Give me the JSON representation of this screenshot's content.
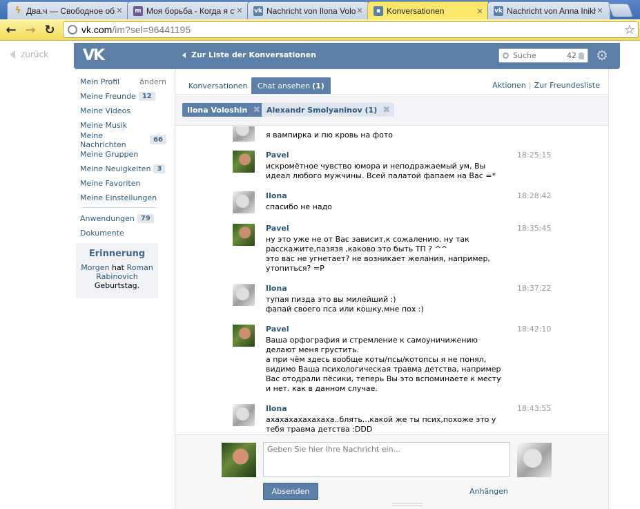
{
  "browser": {
    "tabs": [
      {
        "title": "Два.ч — Свободное общ",
        "icon": "lightning-icon",
        "active": false
      },
      {
        "title": "Моя борьба - Когда я ст",
        "icon": "m-favicon",
        "active": false
      },
      {
        "title": "Nachricht von Ilona Volosh",
        "icon": "vk-favicon",
        "active": false
      },
      {
        "title": "Konversationen",
        "icon": "chat-favicon",
        "active": true
      },
      {
        "title": "Nachricht von Anna Inikho",
        "icon": "vk-favicon",
        "active": false
      }
    ],
    "url_host": "vk.com",
    "url_path": "/im?sel=96441195"
  },
  "vk": {
    "back_label": "zurück",
    "header_link": "Zur Liste der Konversationen",
    "search_placeholder": "Suche",
    "search_count": "42"
  },
  "sidebar": {
    "profile": "Mein Profil",
    "change": "ändern",
    "items": [
      {
        "label": "Meine Freunde",
        "badge": "12"
      },
      {
        "label": "Meine Videos",
        "badge": ""
      },
      {
        "label": "Meine Musik",
        "badge": ""
      },
      {
        "label": "Meine Nachrichten",
        "badge": "66"
      },
      {
        "label": "Meine Gruppen",
        "badge": ""
      },
      {
        "label": "Meine Neuigkeiten",
        "badge": "3"
      },
      {
        "label": "Meine Favoriten",
        "badge": ""
      },
      {
        "label": "Meine Einstellungen",
        "badge": ""
      }
    ],
    "apps": {
      "label": "Anwendungen",
      "badge": "79"
    },
    "docs": "Dokumente",
    "reminder": {
      "title": "Erinnerung",
      "when": "Morgen",
      "has": "hat",
      "name": "Roman Rabinovich",
      "what": "Geburtstag."
    }
  },
  "main": {
    "tab_conversations": "Konversationen",
    "tab_chat": "Chat ansehen",
    "tab_chat_count": "(1)",
    "actions": "Aktionen",
    "to_friends": "Zur Freundesliste",
    "chips": [
      {
        "label": "Ilona Voloshin",
        "active": true
      },
      {
        "label": "Alexandr Smolyaninov (1)",
        "active": false
      }
    ]
  },
  "messages": [
    {
      "author": "",
      "time": "",
      "text": "я вампирка и пю кровь на фото",
      "avatar": "ilona"
    },
    {
      "author": "Pavel",
      "time": "18:25:15",
      "text": "искромётное чувство юмора и неподражаемый ум, Вы идеал любого мужчины. Всей палатой фапаем на Вас =*",
      "avatar": "pavel"
    },
    {
      "author": "Ilona",
      "time": "18:28:42",
      "text": "спасибо не надо",
      "avatar": "ilona"
    },
    {
      "author": "Pavel",
      "time": "18:35:45",
      "text": "ну это уже не от Вас зависит,к сожалению. ну так расскажите,пазязя ,каково это быть ТП ? ^^\nэто вас не угнетает? не возникает желания, например, утопиться? =P",
      "avatar": "pavel"
    },
    {
      "author": "Ilona",
      "time": "18:37:22",
      "text": "тупая пизда это вы милейший :)\nфапай своего пса или кошку,мне пох :)",
      "avatar": "ilona"
    },
    {
      "author": "Pavel",
      "time": "18:42:10",
      "text": "Ваша орфография и стремление к самоуничижению делают меня грустить.\nа при чём здесь вообще коты/псы/котопсы я не понял, видимо Ваша психологическая травма детства, например Вас отодрали пёсики, теперь Вы это вспоминаете к месту и нет. как в данном случае.",
      "avatar": "pavel"
    },
    {
      "author": "Ilona",
      "time": "18:43:55",
      "text": "ахахахахахахаха..блять...какой же ты псих,похоже это у тебя травма детства :DDD",
      "avatar": "ilona"
    }
  ],
  "compose": {
    "placeholder": "Geben Sie hier Ihre Nachricht ein...",
    "send": "Absenden",
    "attach": "Anhängen"
  }
}
